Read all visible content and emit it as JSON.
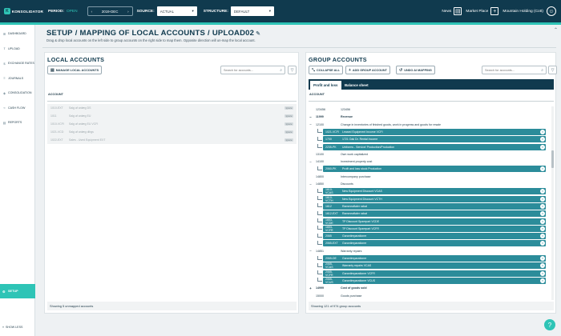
{
  "header": {
    "logo_text": "KONSOLIDATOR",
    "period_label": "PERIOD:",
    "period_state": "OPEN",
    "period_value": "2019-DEC",
    "source_label": "SOURCE:",
    "source_value": "ACTUAL",
    "structure_label": "STRUCTURE:",
    "structure_value": "DEFAULT",
    "news_label": "News",
    "marketplace_label": "Market Place",
    "company_name": "Mountain Holding (Cott)"
  },
  "sidebar": {
    "items": [
      {
        "label": "DASHBOARD",
        "icon": "⊞"
      },
      {
        "label": "UPLOAD",
        "icon": "⇪"
      },
      {
        "label": "EXCHANGE RATES",
        "icon": "$"
      },
      {
        "label": "JOURNALS",
        "icon": "≡"
      },
      {
        "label": "CONSOLIDATION",
        "icon": "◈"
      },
      {
        "label": "CASH FLOW",
        "icon": "≈"
      },
      {
        "label": "REPORTS",
        "icon": "▤"
      }
    ],
    "setup_label": "SETUP",
    "show_less_label": "SHOW LESS"
  },
  "page": {
    "crumb_1": "SETUP",
    "crumb_2": "MAPPING OF LOCAL ACCOUNTS",
    "crumb_3": "UPLOAD02",
    "subtitle": "Drag & drop local accounts on the left side to group accounts on the right side to map them. Opposite direction will un-map the local account."
  },
  "local": {
    "title": "LOCAL ACCOUNTS",
    "manage_button": "MANAGE LOCAL ACCOUNTS",
    "search_placeholder": "Search for accounts...",
    "column_header": "ACCOUNT",
    "rows": [
      {
        "code": "1010-EXT",
        "desc": "Salg af anlæg DS",
        "badge": "Ignore"
      },
      {
        "code": "1011",
        "desc": "Salg af anlæg EU",
        "badge": "Ignore"
      },
      {
        "code": "1010-VCFI",
        "desc": "Salg af anlæg EU VCFI",
        "badge": "Ignore"
      },
      {
        "code": "1021-VCD",
        "desc": "Salg af anlæg dilrgs",
        "badge": "Ignore"
      },
      {
        "code": "1022-EXT",
        "desc": "Sales - Used Equipment EXT",
        "badge": "Ignore"
      }
    ],
    "footer": "Showing 5 unmapped accounts"
  },
  "group": {
    "title": "GROUP ACCOUNTS",
    "collapse_button": "COLLAPSE ALL",
    "add_button": "ADD GROUP ACCOUNT",
    "undo_button": "UNDO AI MAPPING",
    "search_placeholder": "Search for accounts...",
    "tab_1": "Profit and loss",
    "tab_2": "Balance sheet",
    "column_header": "ACCOUNT",
    "rows": [
      {
        "type": "header",
        "code": "123456",
        "desc": "123456"
      },
      {
        "type": "header",
        "toggle": "−",
        "code": "11999",
        "desc": "Revenue",
        "bold": true
      },
      {
        "type": "header",
        "toggle": "−",
        "code": "12100",
        "desc": "Change in inventories of finished goods, work in progress and goods for resale"
      },
      {
        "type": "chip",
        "code": "1021-VCFI",
        "desc": "Leased Equipment Income VCFI"
      },
      {
        "type": "chip",
        "code": "1700",
        "desc": "1721 Oak Dr. Rental Income"
      },
      {
        "type": "chip",
        "code": "2235-PK",
        "desc": "Uniforms - Service/ Production/Production"
      },
      {
        "type": "header",
        "code": "13100",
        "desc": "Own work capitalized"
      },
      {
        "type": "header",
        "toggle": "−",
        "code": "14100",
        "desc": "Investment property cost"
      },
      {
        "type": "chip",
        "code": "2060-PK",
        "desc": "Profit and loss stock Production"
      },
      {
        "type": "header",
        "code": "14800",
        "desc": "Intercompany purchase"
      },
      {
        "type": "header",
        "toggle": "−",
        "code": "14850",
        "desc": "Discounts"
      },
      {
        "type": "chip",
        "code": "1610-VCAS",
        "desc": "New Equipment Discount VCAS"
      },
      {
        "type": "chip",
        "code": "1610-VCTH",
        "desc": "New Equipment Discount VCTH"
      },
      {
        "type": "chip",
        "code": "1612",
        "desc": "Rammeaftaler rabat"
      },
      {
        "type": "chip",
        "code": "1612-EXT",
        "desc": "Rammeaftaler rabat"
      },
      {
        "type": "chip",
        "code": "1653-VCDE",
        "desc": "TP Discount Sparepart VCDE"
      },
      {
        "type": "chip",
        "code": "1653-VCFR",
        "desc": "TP Discount Sparepart VCFR"
      },
      {
        "type": "chip",
        "code": "2065",
        "desc": "Garantireparationer"
      },
      {
        "type": "chip",
        "code": "2065-EXT",
        "desc": "Garantireparationer"
      },
      {
        "type": "header",
        "toggle": "−",
        "code": "14851",
        "desc": "Warranty repairs"
      },
      {
        "type": "chip",
        "code": "2065-DE",
        "desc": "Garantireparationer"
      },
      {
        "type": "chip",
        "code": "2065-VCAS",
        "desc": "Warranty repairs VCAS"
      },
      {
        "type": "chip",
        "code": "2065-VCFR",
        "desc": "Garantireparationer VCFR"
      },
      {
        "type": "chip",
        "code": "2065-VCUS",
        "desc": "Garantireparationer VCUS"
      },
      {
        "type": "header",
        "toggle": "+",
        "code": "14999",
        "desc": "Cost of goods sold",
        "bold": true
      },
      {
        "type": "header",
        "code": "15000",
        "desc": "Goods purchase"
      }
    ],
    "footer": "Showing 121 of 974 group accounts"
  }
}
